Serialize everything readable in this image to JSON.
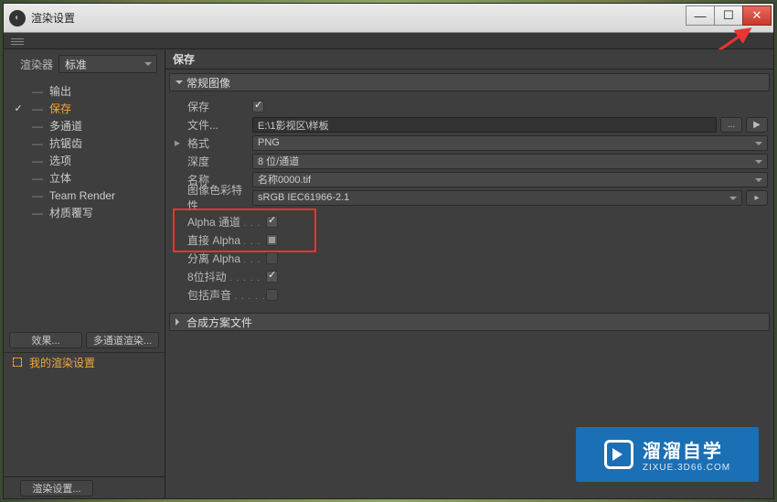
{
  "window": {
    "title": "渲染设置"
  },
  "winControls": {
    "min": "—",
    "max": "☐",
    "close": "✕"
  },
  "sidebar": {
    "rendererLabel": "渲染器",
    "rendererValue": "标准",
    "items": [
      {
        "label": "输出",
        "mark": ""
      },
      {
        "label": "保存",
        "mark": "✓",
        "active": true
      },
      {
        "label": "多通道",
        "mark": ""
      },
      {
        "label": "抗锯齿",
        "mark": ""
      },
      {
        "label": "选项",
        "mark": ""
      },
      {
        "label": "立体",
        "mark": ""
      },
      {
        "label": "Team Render",
        "mark": ""
      },
      {
        "label": "材质覆写",
        "mark": ""
      }
    ],
    "effectsBtn": "效果...",
    "multiBtn": "多通道渲染...",
    "mySettings": "我的渲染设置",
    "bottomBtn": "渲染设置..."
  },
  "main": {
    "header": "保存",
    "section1": "常规图像",
    "section2": "合成方案文件",
    "rows": {
      "saveLabel": "保存",
      "fileLabel": "文件...",
      "fileValue": "E:\\1影视区\\样板",
      "browse": "...",
      "play": "▶",
      "formatLabel": "格式",
      "formatValue": "PNG",
      "depthLabel": "深度",
      "depthValue": "8 位/通道",
      "nameLabel": "名称",
      "nameValue": "名称0000.tif",
      "colorLabel": "图像色彩特性",
      "colorValue": "sRGB IEC61966-2.1",
      "alphaLabel": "Alpha 通道",
      "straightLabel": "直接 Alpha",
      "sepLabel": "分离 Alpha",
      "ditherLabel": "8位抖动",
      "audioLabel": "包括声音"
    }
  },
  "watermark": {
    "big": "溜溜自学",
    "small": "ZIXUE.3D66.COM"
  }
}
